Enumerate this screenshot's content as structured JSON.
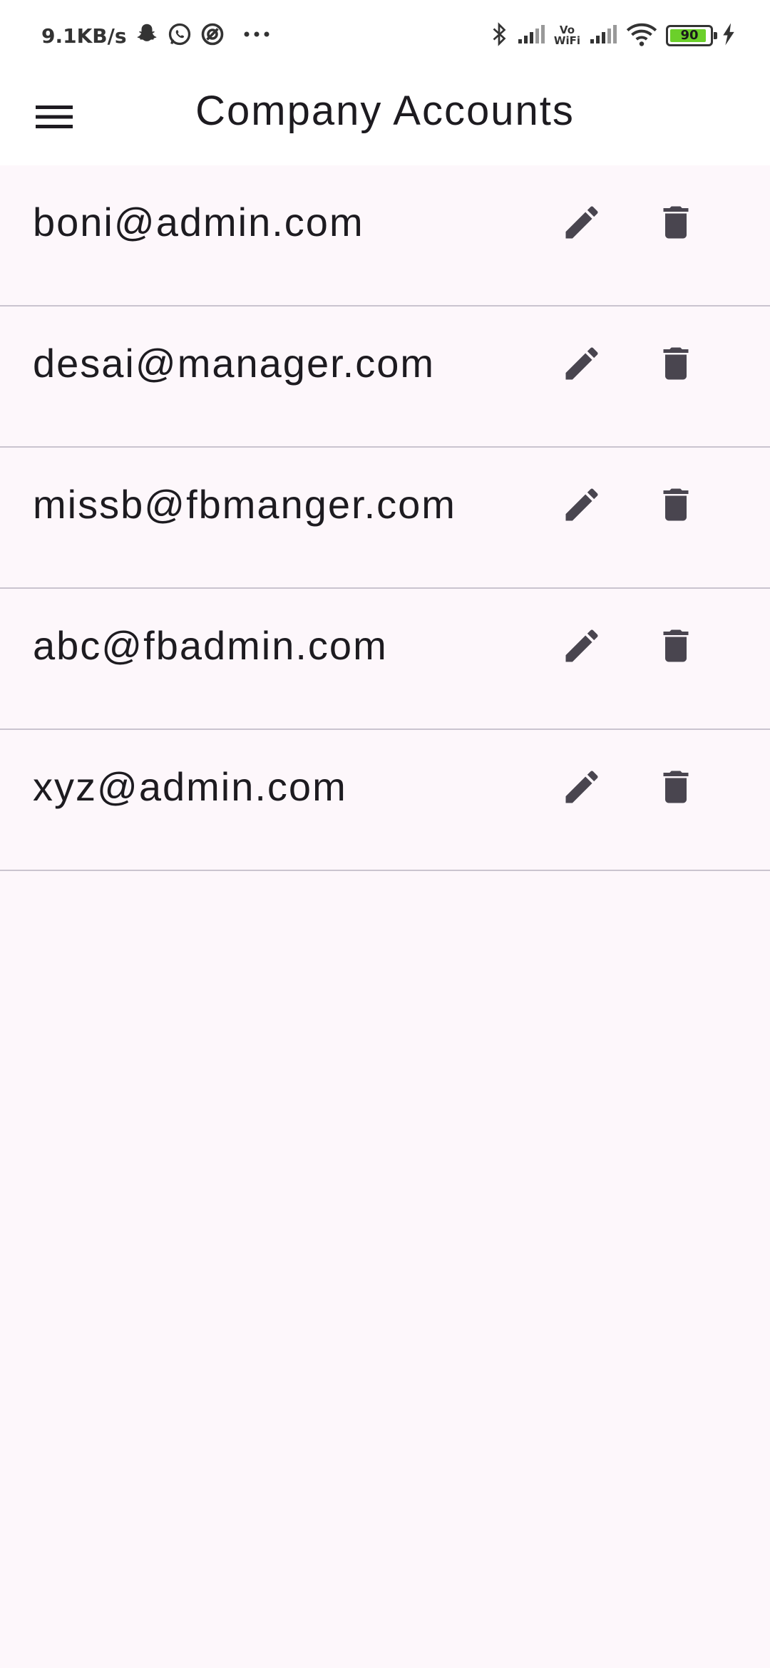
{
  "status_bar": {
    "net_speed": "9.1KB/s",
    "left_icons": [
      "snapchat-icon",
      "whatsapp-icon",
      "app-notification-icon",
      "more-dots-icon"
    ],
    "right_icons": [
      "bluetooth-icon",
      "signal-icon",
      "vowifi-icon",
      "signal-icon",
      "wifi-icon",
      "battery-icon",
      "charging-icon"
    ],
    "vowifi_top": "Vo",
    "vowifi_bottom": "WiFi",
    "battery_level": "90",
    "battery_color": "#6bd02a"
  },
  "app_bar": {
    "menu_icon": "menu-icon",
    "title": "Company Accounts"
  },
  "accounts": [
    {
      "email": "boni@admin.com"
    },
    {
      "email": "desai@manager.com"
    },
    {
      "email": "missb@fbmanger.com"
    },
    {
      "email": "abc@fbadmin.com"
    },
    {
      "email": "xyz@admin.com"
    }
  ],
  "row_icons": {
    "edit": "edit-pencil-icon",
    "delete": "delete-trash-icon"
  },
  "colors": {
    "background": "#fdf7fb",
    "app_bar": "#ffffff",
    "icon": "#49454f",
    "divider": "#cac4cf",
    "text": "#1d1b20"
  }
}
